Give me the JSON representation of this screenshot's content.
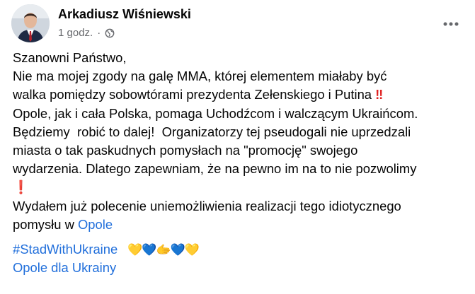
{
  "author": {
    "name": "Arkadiusz Wiśniewski",
    "time": "1 godz.",
    "separator": "·"
  },
  "icons": {
    "privacy": "globe-icon",
    "menu": "more-horizontal-icon",
    "emphasis": "double-exclamation-emoji",
    "emphasis_single": "exclamation-emoji"
  },
  "post": {
    "lines": [
      "Szanowni Państwo,",
      "Nie ma mojej zgody na galę MMA, której elementem miałaby być",
      "walka pomiędzy sobowtórami prezydenta Zełenskiego i Putina ",
      "Opole, jak i cała Polska, pomaga Uchodźcom i walczącym Ukraińcom.",
      "Będziemy  robić to dalej!  Organizatorzy tej pseudogali nie uprzedzali",
      "miasta o tak paskudnych pomysłach na \"promocję\" swojego",
      "wydarzenia. Dlatego zapewniam, że na pewno im na to nie pozwolimy"
    ],
    "double_excl": "‼",
    "single_excl": "❗",
    "closing_line": "Wydałem już polecenie uniemożliwienia realizacji tego idiotycznego",
    "closing_prefix": "pomysłu w ",
    "closing_link": "Opole",
    "hashtag_1": "#StadWithUkraine",
    "hearts": "💛💙🫱💙💛",
    "hashtag_2": "Opole dla Ukrainy"
  },
  "colors": {
    "link": "#216fdb",
    "meta": "#65676b",
    "text": "#050505",
    "exclamation": "#e02424"
  }
}
